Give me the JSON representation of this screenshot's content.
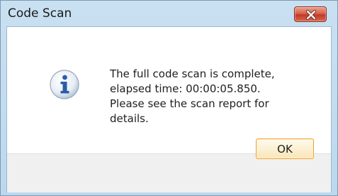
{
  "window": {
    "title": "Code Scan",
    "close_icon": "close-icon"
  },
  "message": {
    "icon": "info-icon",
    "lines": [
      "The full code scan is complete,",
      "elapsed time: 00:00:05.850.",
      "Please see the scan report for",
      "details."
    ]
  },
  "buttons": {
    "ok_label": "OK"
  },
  "colors": {
    "titlebar": "#bcd8ee",
    "close_button": "#c0392b",
    "info_icon": "#2a5ea8",
    "ok_border": "#f2a12b",
    "footer": "#f0f0f0"
  }
}
